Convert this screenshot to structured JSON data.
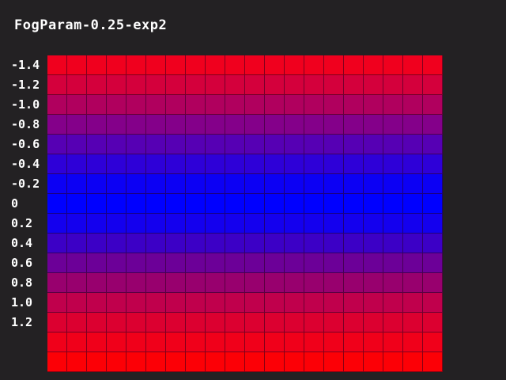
{
  "title": "FogParam-0.25-exp2",
  "row_labels": [
    "-1.4",
    "-1.2",
    "-1.0",
    "-0.8",
    "-0.6",
    "-0.4",
    "-0.2",
    "0",
    "0.2",
    "0.4",
    "0.6",
    "0.8",
    "1.0",
    "1.2"
  ],
  "grid": {
    "rows": 16,
    "cols": 20,
    "row_colors": [
      "#f0001e",
      "#d4003c",
      "#b0005e",
      "#84008a",
      "#5600b4",
      "#2e00d8",
      "#0c00f4",
      "#0000ff",
      "#1400ee",
      "#3c00c6",
      "#6c0098",
      "#98006e",
      "#c0004c",
      "#dc0030",
      "#f0001a",
      "#fc0006"
    ]
  }
}
